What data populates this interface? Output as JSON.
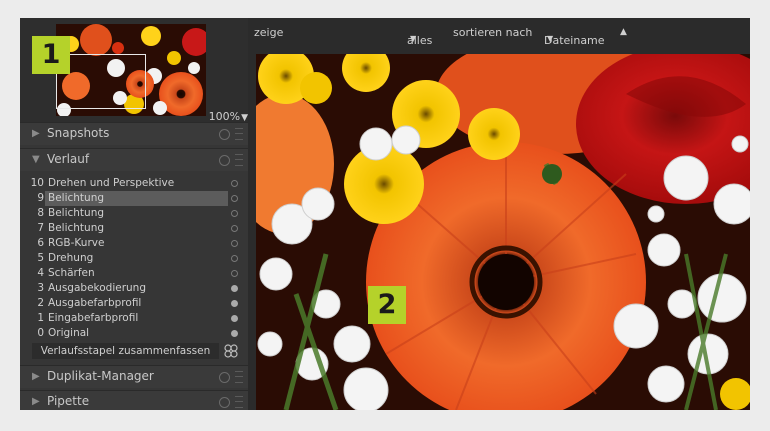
{
  "navigation": {
    "zoom_value": "100%",
    "zoom_caret": "▼",
    "badge": "1"
  },
  "modules": {
    "snapshots": {
      "arrow": "▶",
      "title": "Snapshots"
    },
    "history": {
      "arrow": "▼",
      "title": "Verlauf"
    },
    "duplicate_manager": {
      "arrow": "▶",
      "title": "Duplikat-Manager"
    },
    "pipette": {
      "arrow": "▶",
      "title": "Pipette"
    }
  },
  "history_items": [
    {
      "num": "10",
      "label": "Drehen und Perspektive",
      "active": false,
      "selected": false
    },
    {
      "num": "9",
      "label": "Belichtung",
      "active": false,
      "selected": true
    },
    {
      "num": "8",
      "label": "Belichtung",
      "active": false,
      "selected": false
    },
    {
      "num": "7",
      "label": "Belichtung",
      "active": false,
      "selected": false
    },
    {
      "num": "6",
      "label": "RGB-Kurve",
      "active": false,
      "selected": false
    },
    {
      "num": "5",
      "label": "Drehung",
      "active": false,
      "selected": false
    },
    {
      "num": "4",
      "label": "Schärfen",
      "active": false,
      "selected": false
    },
    {
      "num": "3",
      "label": "Ausgabekodierung",
      "active": true,
      "selected": false
    },
    {
      "num": "2",
      "label": "Ausgabefarbprofil",
      "active": true,
      "selected": false
    },
    {
      "num": "1",
      "label": "Eingabefarbprofil",
      "active": true,
      "selected": false
    },
    {
      "num": "0",
      "label": "Original",
      "active": true,
      "selected": false
    }
  ],
  "compress_button": "Verlaufsstapel zusammenfassen",
  "topbar": {
    "show_label": "zeige",
    "filter_value": "alles",
    "filter_caret": "▼",
    "sort_label": "sortieren nach",
    "sort_value": "Dateiname",
    "sort_caret": "▼",
    "sort_direction": "▲"
  },
  "image": {
    "badge": "2"
  },
  "colors": {
    "accent_badge": "#b5d22a",
    "panel_bg": "#363636",
    "selected_row": "#5c5c5c"
  }
}
